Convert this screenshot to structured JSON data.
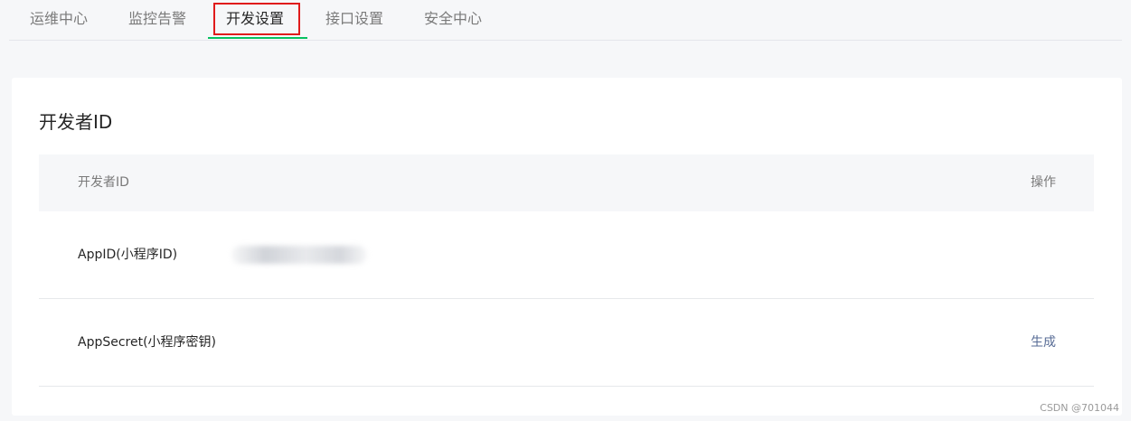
{
  "nav": {
    "tabs": [
      {
        "label": "运维中心",
        "active": false
      },
      {
        "label": "监控告警",
        "active": false
      },
      {
        "label": "开发设置",
        "active": true
      },
      {
        "label": "接口设置",
        "active": false
      },
      {
        "label": "安全中心",
        "active": false
      }
    ]
  },
  "section": {
    "title": "开发者ID",
    "table": {
      "columns": [
        "开发者ID",
        "操作"
      ],
      "rows": [
        {
          "label": "AppID(小程序ID)",
          "value": "",
          "action": ""
        },
        {
          "label": "AppSecret(小程序密钥)",
          "value": "",
          "action": "生成"
        }
      ]
    }
  },
  "watermark": "CSDN @701044",
  "colors": {
    "active_underline": "#07c160",
    "highlight_border": "#e01b1b",
    "link": "#576b95"
  }
}
